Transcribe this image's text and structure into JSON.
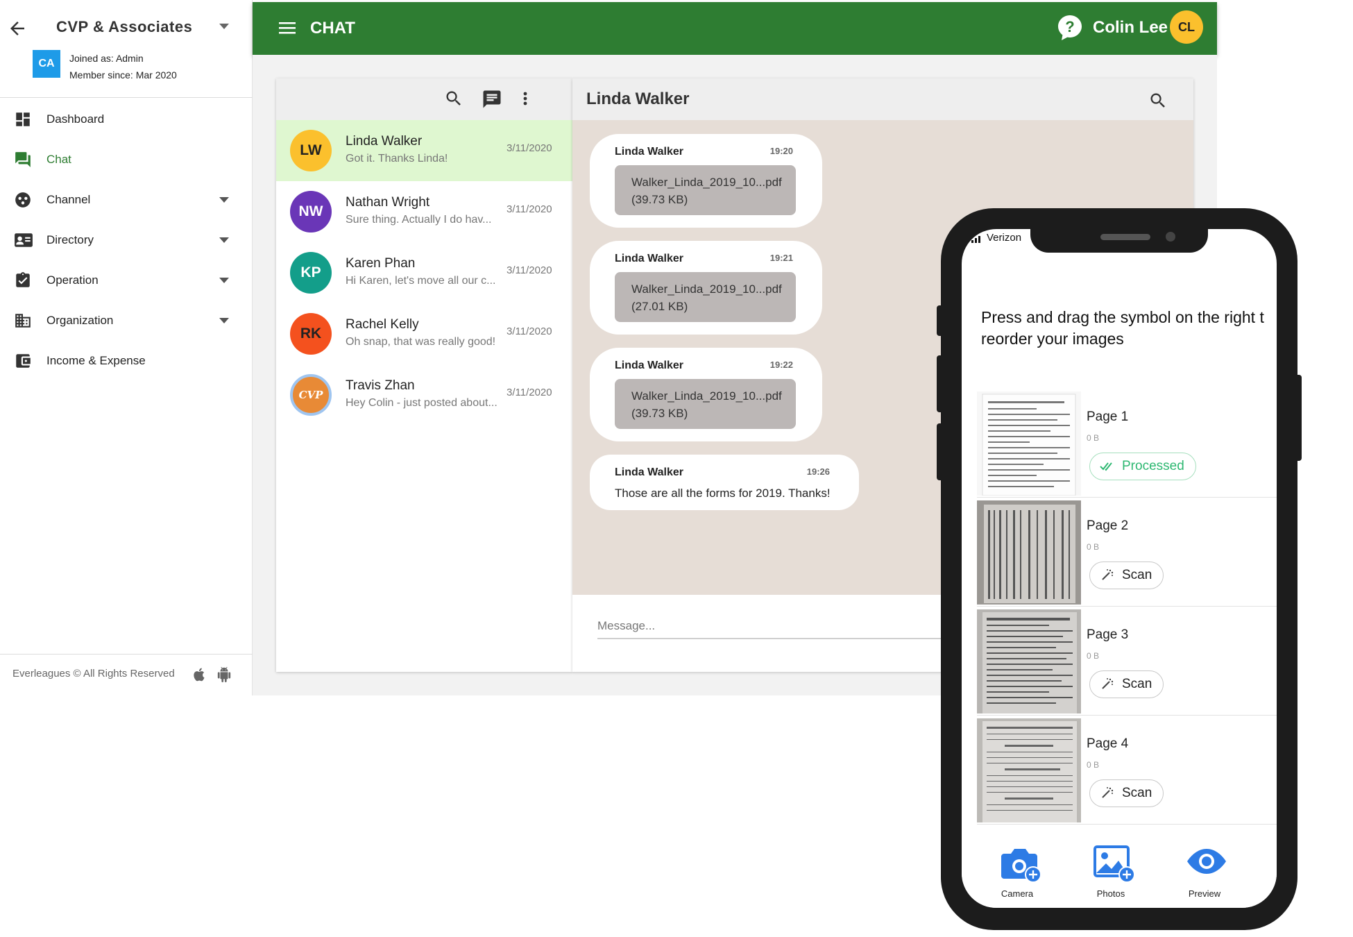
{
  "sidebar": {
    "org_name": "CVP & Associates",
    "org_initials": "CA",
    "joined_as": "Joined as: Admin",
    "member_since": "Member since: Mar 2020",
    "items": [
      {
        "label": "Dashboard",
        "icon": "dashboard-icon"
      },
      {
        "label": "Chat",
        "icon": "chat-icon",
        "active": true
      },
      {
        "label": "Channel",
        "icon": "channel-icon",
        "expandable": true
      },
      {
        "label": "Directory",
        "icon": "contact-card-icon",
        "expandable": true
      },
      {
        "label": "Operation",
        "icon": "clipboard-check-icon",
        "expandable": true
      },
      {
        "label": "Organization",
        "icon": "building-icon",
        "expandable": true
      },
      {
        "label": "Income & Expense",
        "icon": "wallet-icon"
      }
    ],
    "footer": "Everleagues © All Rights Reserved"
  },
  "header": {
    "title": "CHAT",
    "user_name": "Colin Lee",
    "user_initials": "CL"
  },
  "conversations": [
    {
      "initials": "LW",
      "name": "Linda Walker",
      "preview": "Got it. Thanks Linda!",
      "date": "3/11/2020",
      "color": "#fbc02d",
      "text_color": "#222222",
      "active": true
    },
    {
      "initials": "NW",
      "name": "Nathan Wright",
      "preview": "Sure thing. Actually I do hav...",
      "date": "3/11/2020",
      "color": "#6a36b7",
      "text_color": "#ffffff"
    },
    {
      "initials": "KP",
      "name": "Karen Phan",
      "preview": "Hi Karen, let's move all our c...",
      "date": "3/11/2020",
      "color": "#139e8a",
      "text_color": "#ffffff"
    },
    {
      "initials": "RK",
      "name": "Rachel Kelly",
      "preview": "Oh snap, that was really good!",
      "date": "3/11/2020",
      "color": "#f4511e",
      "text_color": "#222222"
    },
    {
      "initials": "CVP",
      "name": "Travis Zhan",
      "preview": "Hey Colin - just posted about...",
      "date": "3/11/2020",
      "color": "#e88a36",
      "text_color": "#ffffff"
    }
  ],
  "chat": {
    "title": "Linda Walker",
    "messages": [
      {
        "sender": "Linda Walker",
        "time": "19:20",
        "file_name": "Walker_Linda_2019_10...pdf",
        "file_size": "(39.73 KB)"
      },
      {
        "sender": "Linda Walker",
        "time": "19:21",
        "file_name": "Walker_Linda_2019_10...pdf",
        "file_size": "(27.01 KB)"
      },
      {
        "sender": "Linda Walker",
        "time": "19:22",
        "file_name": "Walker_Linda_2019_10...pdf",
        "file_size": "(39.73 KB)"
      },
      {
        "sender": "Linda Walker",
        "time": "19:26",
        "text": "Those are all the forms for 2019. Thanks!"
      }
    ],
    "composer_placeholder": "Message..."
  },
  "phone": {
    "carrier": "Verizon",
    "instructions_line1": "Press and drag the symbol on the right t",
    "instructions_line2": "reorder your images",
    "pages": [
      {
        "label": "Page 1",
        "size": "0 B",
        "action": "Processed",
        "status": "processed"
      },
      {
        "label": "Page 2",
        "size": "0 B",
        "action": "Scan",
        "status": "scan"
      },
      {
        "label": "Page 3",
        "size": "0 B",
        "action": "Scan",
        "status": "scan"
      },
      {
        "label": "Page 4",
        "size": "0 B",
        "action": "Scan",
        "status": "scan"
      }
    ],
    "tabs": [
      {
        "label": "Camera",
        "icon": "camera-add-icon"
      },
      {
        "label": "Photos",
        "icon": "photos-add-icon"
      },
      {
        "label": "Preview",
        "icon": "eye-icon"
      }
    ]
  },
  "colors": {
    "header_green": "#2e7d32",
    "active_conv_bg": "#dff7d0",
    "chat_bg": "#e6ddd6",
    "accent_blue": "#2d7be5",
    "processed_green": "#2eb872"
  }
}
